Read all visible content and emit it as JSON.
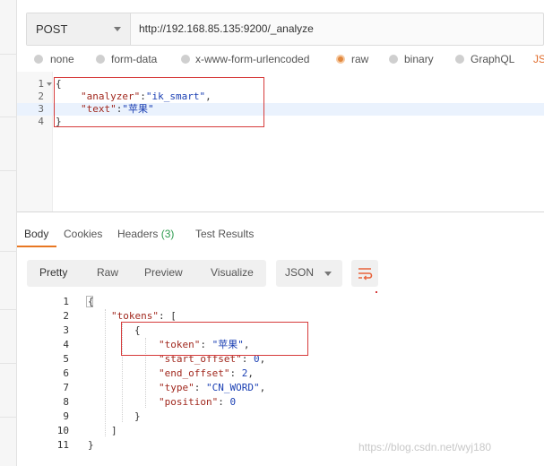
{
  "request": {
    "method": "POST",
    "url": "http://192.168.85.135:9200/_analyze"
  },
  "body_types": {
    "none": "none",
    "form_data": "form-data",
    "x_www": "x-www-form-urlencoded",
    "raw": "raw",
    "binary": "binary",
    "graphql": "GraphQL",
    "json_cut": "JS"
  },
  "request_body": {
    "line_numbers": [
      "1",
      "2",
      "3",
      "4"
    ],
    "open_brace": "{",
    "close_brace": "}",
    "analyzer_key": "\"analyzer\"",
    "analyzer_val": "\"ik_smart\"",
    "text_key": "\"text\"",
    "text_val": "\"苹果\""
  },
  "response_tabs": {
    "body": "Body",
    "cookies": "Cookies",
    "headers": "Headers",
    "headers_count": "(3)",
    "tests": "Test Results"
  },
  "view_modes": {
    "pretty": "Pretty",
    "raw": "Raw",
    "preview": "Preview",
    "visualize": "Visualize"
  },
  "format_select": "JSON",
  "accent_color": "#e87722",
  "response_body": {
    "line_numbers": [
      "1",
      "2",
      "3",
      "4",
      "5",
      "6",
      "7",
      "8",
      "9",
      "10",
      "11"
    ],
    "tokens_key": "\"tokens\"",
    "token_key": "\"token\"",
    "token_val": "\"苹果\"",
    "start_offset_key": "\"start_offset\"",
    "start_offset_val": "0",
    "end_offset_key": "\"end_offset\"",
    "end_offset_val": "2",
    "type_key": "\"type\"",
    "type_val": "\"CN_WORD\"",
    "position_key": "\"position\"",
    "position_val": "0"
  },
  "watermark": "https://blog.csdn.net/wyj180"
}
